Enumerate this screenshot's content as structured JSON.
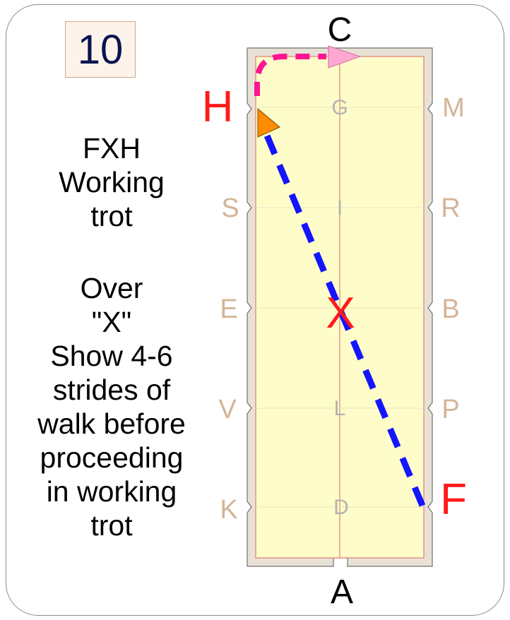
{
  "test_number": "10",
  "movement": [
    "FXH",
    "Working",
    "trot"
  ],
  "note": [
    "Over",
    "\"X\"",
    "Show 4-6",
    "strides of",
    "walk before",
    "proceeding",
    "in working",
    "trot"
  ],
  "arena": {
    "end_letters": {
      "top": "C",
      "bottom": "A"
    },
    "left_letters": [
      "S",
      "E",
      "V",
      "K"
    ],
    "right_letters": [
      "M",
      "R",
      "B",
      "P"
    ],
    "centerline_letters": [
      "G",
      "I",
      "L",
      "D"
    ],
    "highlighted_letters": {
      "start": "F",
      "center": "X",
      "end": "H"
    }
  },
  "colors": {
    "arena_fill": "#fefcc8",
    "arena_wall": "#e8e2d6",
    "diagonal_path": "#1414ff",
    "curve_path": "#ff1493",
    "start_arrow": "#ff8c00",
    "end_arrow": "#ffa8d2",
    "highlight_letter": "#ff1a1a"
  }
}
